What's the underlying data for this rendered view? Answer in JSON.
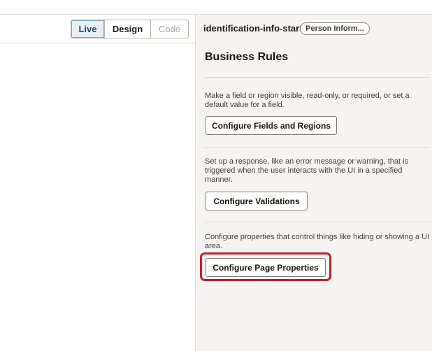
{
  "mode_switch": {
    "live": "Live",
    "design": "Design",
    "code": "Code",
    "selected": "Live"
  },
  "panel": {
    "header_title": "identification-info-start",
    "header_badge": "Person Inform...",
    "section_title": "Business Rules",
    "sections": [
      {
        "description": "Make a field or region visible, read-only, or required, or set a default value for a field.",
        "button": "Configure Fields and Regions"
      },
      {
        "description": "Set up a response, like an error message or warning, that is triggered when the user interacts with the UI in a specified manner.",
        "button": "Configure Validations"
      },
      {
        "description": "Configure properties that control things like hiding or showing a UI area.",
        "button": "Configure Page Properties"
      }
    ]
  },
  "colors": {
    "highlight": "#c71f27",
    "panel_bg": "#f5f4f2",
    "live_selected_bg": "#e4eff6"
  }
}
